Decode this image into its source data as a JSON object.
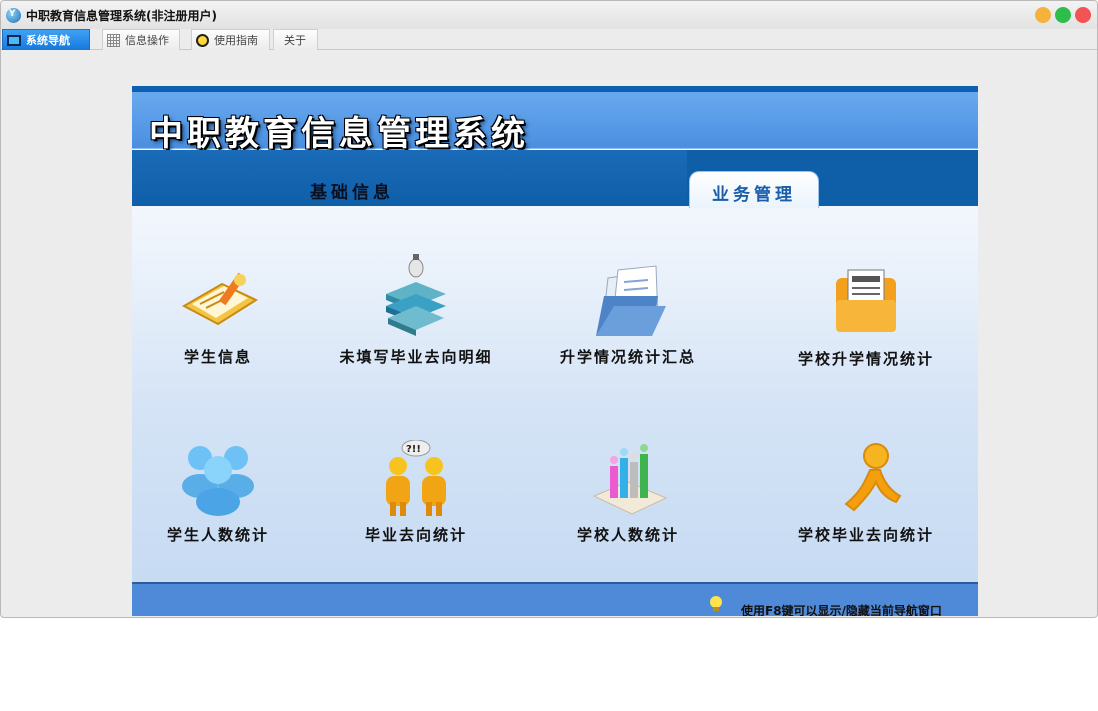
{
  "window": {
    "title": "中职教育信息管理系统(非注册用户)",
    "controls": [
      "minimize",
      "maximize",
      "close"
    ]
  },
  "tabs": [
    {
      "label": "系统导航",
      "icon": "monitor-icon",
      "active": true
    },
    {
      "label": "信息操作",
      "icon": "grid-icon",
      "active": false
    },
    {
      "label": "使用指南",
      "icon": "lightbulb-icon",
      "active": false
    },
    {
      "label": "关于",
      "icon": "",
      "active": false
    }
  ],
  "panel": {
    "system_title": "中职教育信息管理系统",
    "nav_tabs": {
      "basic": "基础信息",
      "business": "业务管理"
    },
    "items": [
      {
        "label": "学生信息",
        "icon": "student-info-icon"
      },
      {
        "label": "未填写毕业去向明细",
        "icon": "books-lamp-icon"
      },
      {
        "label": "升学情况统计汇总",
        "icon": "folder-documents-icon"
      },
      {
        "label": "学校升学情况统计",
        "icon": "orange-folder-icon"
      },
      {
        "label": "学生人数统计",
        "icon": "users-group-icon"
      },
      {
        "label": "毕业去向统计",
        "icon": "people-question-icon"
      },
      {
        "label": "学校人数统计",
        "icon": "bar-people-icon"
      },
      {
        "label": "学校毕业去向统计",
        "icon": "running-man-icon"
      }
    ],
    "footer_tip": "使用F8键可以显示/隐藏当前导航窗口"
  },
  "colors": {
    "active_tab": "#1677de",
    "banner": "#4a8fe0",
    "tab_band": "#0f5ea8",
    "footer": "#4f8ad9"
  }
}
